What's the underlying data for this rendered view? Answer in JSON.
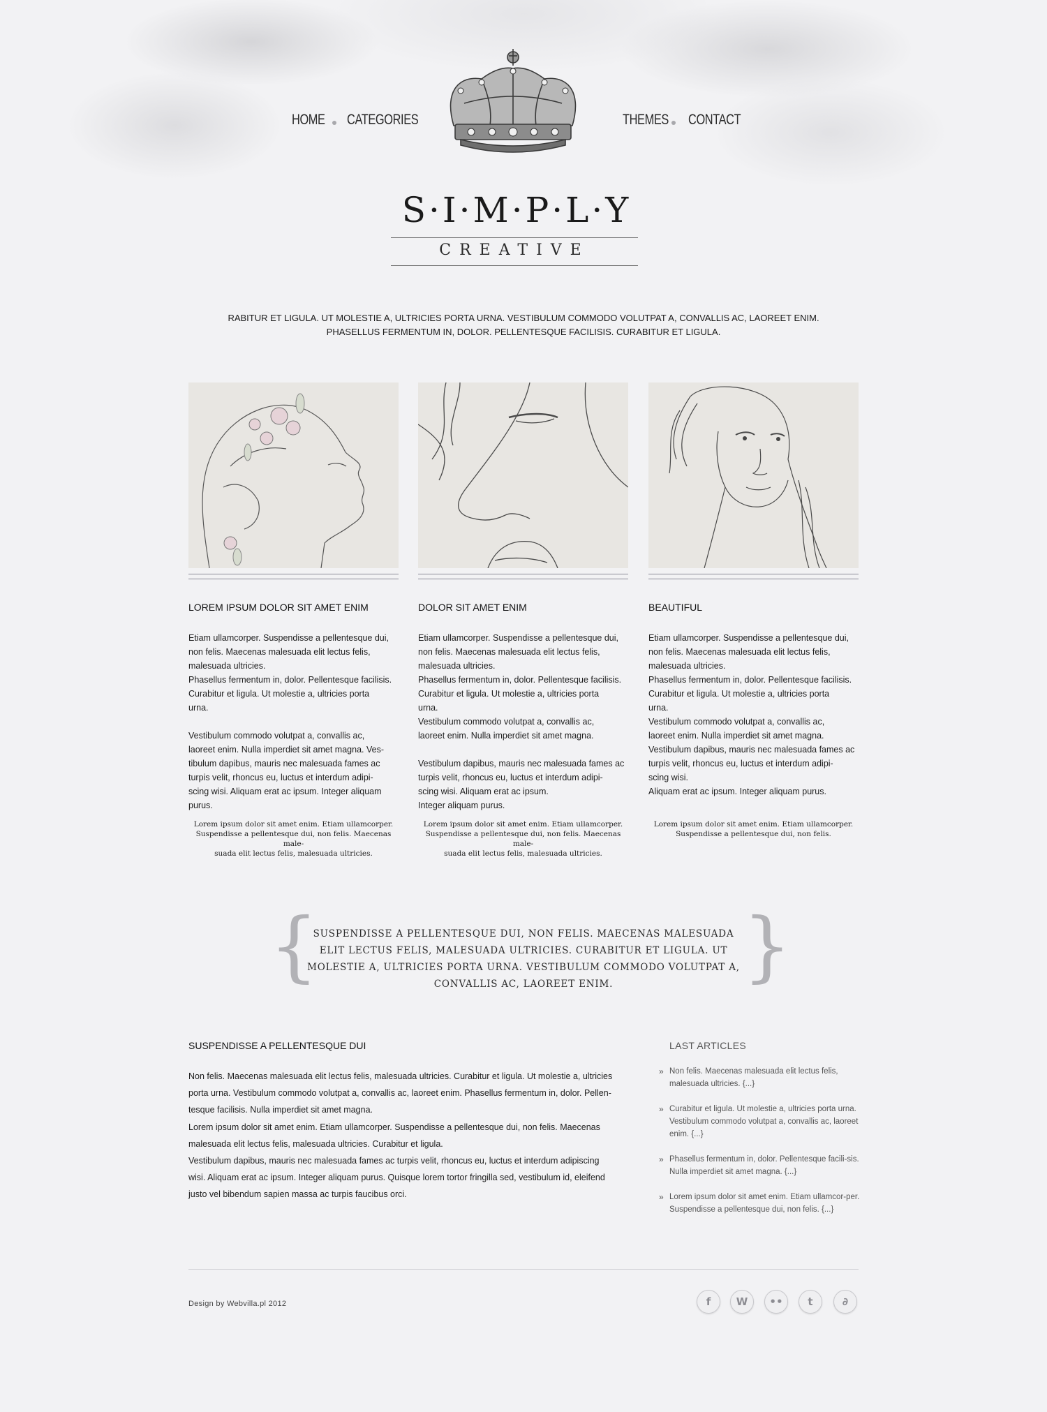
{
  "nav": {
    "left": [
      "HOME",
      "CATEGORIES"
    ],
    "right": [
      "THEMES",
      "CONTACT"
    ]
  },
  "logo": {
    "title": "S·I·M·P·L·Y",
    "subtitle": "CREATIVE"
  },
  "intro": {
    "line1": "RABITUR ET LIGULA. UT MOLESTIE A, ULTRICIES PORTA URNA. VESTIBULUM COMMODO VOLUTPAT A, CONVALLIS AC, LAOREET ENIM.",
    "line2": "PHASELLUS FERMENTUM IN, DOLOR. PELLENTESQUE FACILISIS. CURABITUR ET LIGULA."
  },
  "columns": [
    {
      "heading": "LOREM IPSUM DOLOR SIT AMET ENIM",
      "body": "Etiam ullamcorper. Suspendisse a pellentesque dui,\nnon felis. Maecenas malesuada elit lectus felis,\nmalesuada ultricies.\nPhasellus fermentum in, dolor. Pellentesque facilisis.\nCurabitur et ligula. Ut molestie a, ultricies porta\nurna.\n\nVestibulum commodo volutpat a, convallis ac,\nlaoreet enim. Nulla imperdiet sit amet magna. Ves-\ntibulum dapibus, mauris nec malesuada fames ac\nturpis velit, rhoncus eu, luctus et interdum adipi-\nscing wisi. Aliquam erat ac ipsum. Integer aliquam\npurus.",
      "note": "Lorem ipsum dolor sit amet enim. Etiam ullamcorper.\nSuspendisse a pellentesque dui, non felis. Maecenas male-\nsuada elit lectus felis, malesuada ultricies."
    },
    {
      "heading": "DOLOR SIT AMET ENIM",
      "body": "Etiam ullamcorper. Suspendisse a pellentesque dui,\nnon felis. Maecenas malesuada elit lectus felis,\nmalesuada ultricies.\nPhasellus fermentum in, dolor. Pellentesque facilisis.\nCurabitur et ligula. Ut molestie a, ultricies porta\nurna.\nVestibulum commodo volutpat a, convallis ac,\nlaoreet enim. Nulla imperdiet sit amet magna.\n\nVestibulum dapibus, mauris nec malesuada fames ac\nturpis velit, rhoncus eu, luctus et interdum adipi-\nscing wisi. Aliquam erat ac ipsum.\nInteger aliquam purus.",
      "note": "Lorem ipsum dolor sit amet enim. Etiam ullamcorper.\nSuspendisse a pellentesque dui, non felis. Maecenas male-\nsuada elit lectus felis, malesuada ultricies."
    },
    {
      "heading": "BEAUTIFUL",
      "body": "Etiam ullamcorper. Suspendisse a pellentesque dui,\nnon felis. Maecenas malesuada elit lectus felis,\nmalesuada ultricies.\nPhasellus fermentum in, dolor. Pellentesque facilisis.\nCurabitur et ligula. Ut molestie a, ultricies porta\nurna.\nVestibulum commodo volutpat a, convallis ac,\nlaoreet enim. Nulla imperdiet sit amet magna.\nVestibulum dapibus, mauris nec malesuada fames ac\nturpis velit, rhoncus eu, luctus et interdum adipi-\nscing wisi.\nAliquam erat ac ipsum. Integer aliquam purus.",
      "note": "Lorem ipsum dolor sit amet enim. Etiam ullamcorper.\nSuspendisse a pellentesque dui, non felis."
    }
  ],
  "quote": {
    "text": "Suspendisse a pellentesque dui, non felis. Maecenas malesuada elit lectus felis, malesuada ultricies. Curabitur et ligula. Ut molestie a, ultricies porta urna. Vestibulum commodo volutpat a, convallis ac, laoreet enim."
  },
  "main": {
    "heading": "SUSPENDISSE A PELLENTESQUE DUI",
    "body": "Non felis. Maecenas malesuada elit lectus felis, malesuada ultricies. Curabitur et ligula. Ut molestie a, ultricies\nporta urna. Vestibulum commodo volutpat a, convallis ac, laoreet enim. Phasellus fermentum in, dolor. Pellen-\ntesque facilisis. Nulla imperdiet sit amet magna.\nLorem ipsum dolor sit amet enim. Etiam ullamcorper. Suspendisse a pellentesque dui, non felis. Maecenas\nmalesuada elit lectus felis, malesuada ultricies. Curabitur et ligula.\nVestibulum dapibus, mauris nec malesuada fames ac turpis velit, rhoncus eu, luctus et interdum adipiscing\nwisi. Aliquam erat ac ipsum. Integer aliquam purus. Quisque lorem tortor fringilla sed, vestibulum id, eleifend\njusto vel bibendum sapien massa ac turpis faucibus orci."
  },
  "sidebar": {
    "heading": "LAST ARTICLES",
    "items": [
      "Non felis. Maecenas malesuada elit lectus felis, malesuada ultricies. {...}",
      "Curabitur et ligula. Ut molestie a, ultricies porta urna. Vestibulum commodo volutpat a, convallis ac, laoreet enim. {...}",
      "Phasellus fermentum in, dolor. Pellentesque facili-sis. Nulla imperdiet sit amet magna. {...}",
      "Lorem ipsum dolor sit amet enim. Etiam ullamcor-per. Suspendisse a pellentesque dui, non felis. {...}"
    ]
  },
  "footer": {
    "credit": "Design by Webvilla.pl 2012",
    "social": [
      "facebook-icon",
      "wordpress-icon",
      "flickr-icon",
      "twitter-icon",
      "deviantart-icon"
    ]
  },
  "colors": {
    "background": "#f2f2f4",
    "text": "#1a1a1a",
    "muted": "#555555",
    "brace": "#b2b2b6"
  }
}
